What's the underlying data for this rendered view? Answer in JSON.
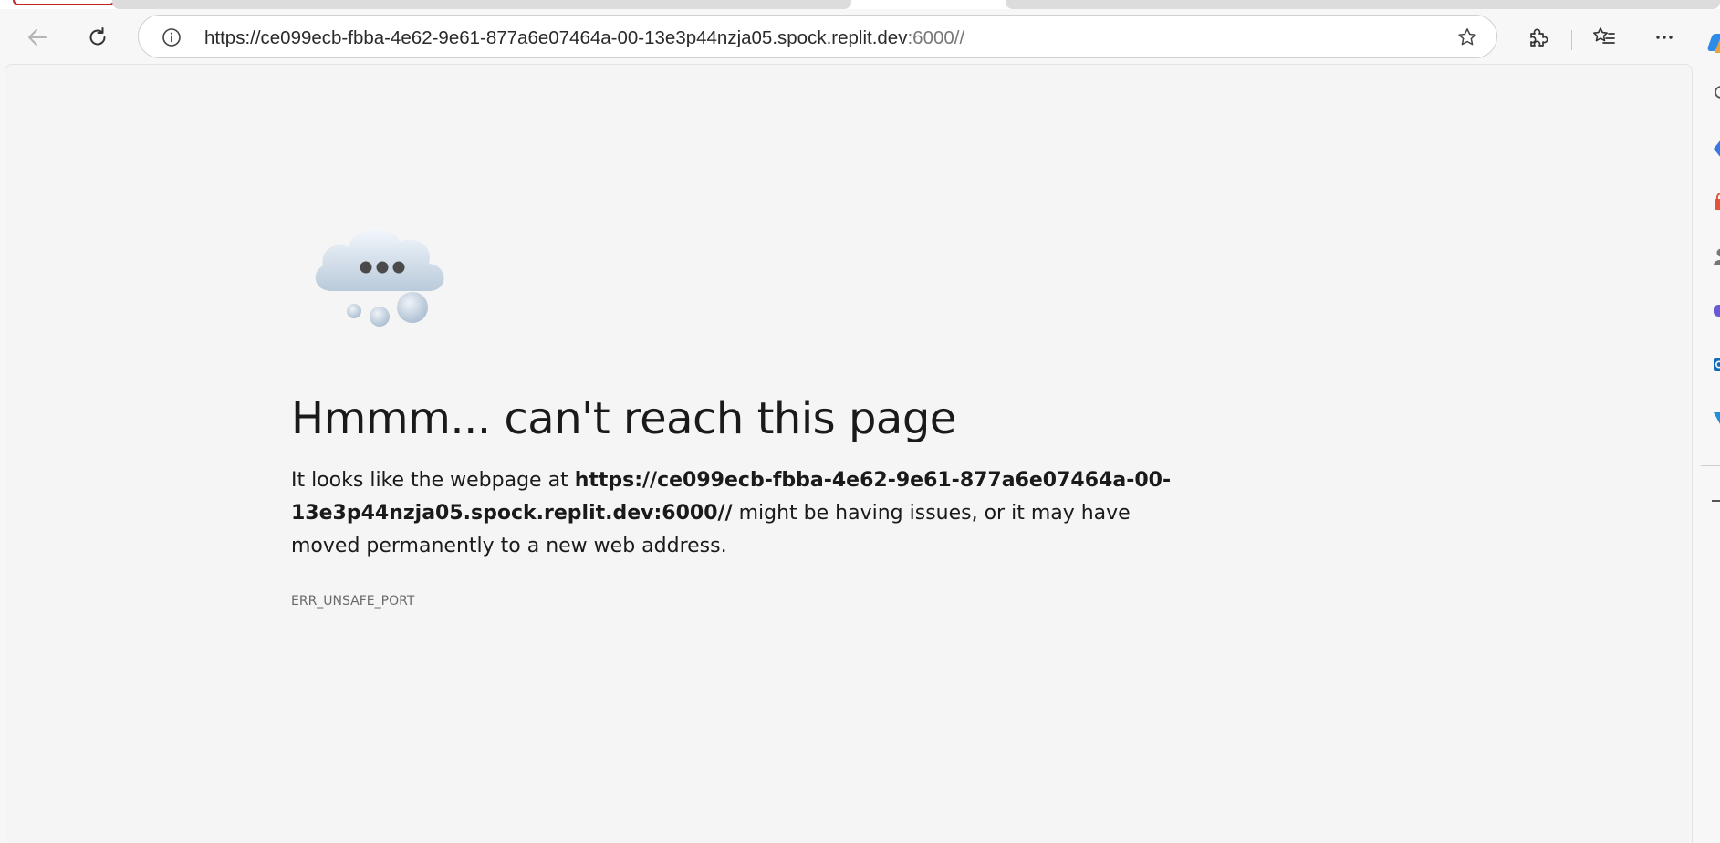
{
  "browser": {
    "address_bar": {
      "url_main": "https://ce099ecb-fbba-4e62-9e61-877a6e07464a-00-13e3p44nzja05.spock.replit.dev",
      "url_port_path": ":6000//"
    },
    "icons": {
      "back": "back-arrow-icon",
      "reload": "reload-icon",
      "site_info": "info-icon",
      "favorite": "star-icon",
      "extensions": "puzzle-icon",
      "favorites_hub": "favorites-list-icon",
      "more": "more-icon",
      "copilot": "copilot-icon"
    },
    "colors": {
      "active_tab_border": "#c4262e",
      "page_background": "#f5f5f5"
    }
  },
  "error_page": {
    "title": "Hmmm... can't reach this page",
    "desc_prefix": "It looks like the webpage at ",
    "desc_url": "https://ce099ecb-fbba-4e62-9e61-877a6e07464a-00-13e3p44nzja05.spock.replit.dev:6000//",
    "desc_suffix": " might be having issues, or it may have moved permanently to a new web address.",
    "error_code": "ERR_UNSAFE_PORT",
    "illustration": "cloud-with-dots-icon"
  },
  "sidebar": {
    "icons": [
      "search-icon",
      "copilot-diamond-icon",
      "shopping-icon",
      "persona-icon",
      "games-icon",
      "outlook-icon",
      "drop-icon",
      "add-icon"
    ]
  }
}
